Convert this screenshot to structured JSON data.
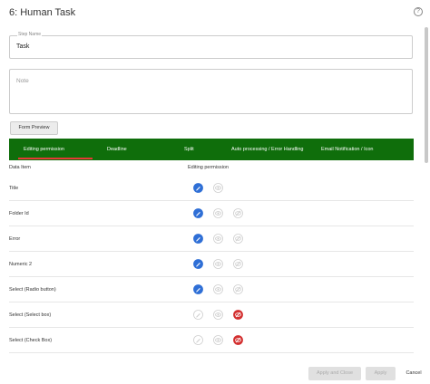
{
  "window": {
    "title": "6: Human Task"
  },
  "step_name": {
    "label": "Step Name",
    "value": "Task"
  },
  "note": {
    "placeholder": "Note"
  },
  "form_preview_label": "Form Preview",
  "tabs": [
    {
      "label": "Editing permission",
      "active": true
    },
    {
      "label": "Deadline",
      "active": false
    },
    {
      "label": "Split",
      "active": false
    },
    {
      "label": "Auto processing / Error Handling",
      "active": false
    },
    {
      "label": "Email Notification / Icon",
      "active": false
    }
  ],
  "table": {
    "headers": [
      "Data Item",
      "Editing permission"
    ],
    "rows": [
      {
        "label": "Title",
        "icons": [
          "edit-active",
          "view-inactive"
        ]
      },
      {
        "label": "Folder Id",
        "icons": [
          "edit-active",
          "view-inactive",
          "hidden-inactive"
        ]
      },
      {
        "label": "Error",
        "icons": [
          "edit-active",
          "view-inactive",
          "hidden-inactive"
        ]
      },
      {
        "label": "Numeric 2",
        "icons": [
          "edit-active",
          "view-inactive",
          "hidden-inactive"
        ]
      },
      {
        "label": "Select (Radio button)",
        "icons": [
          "edit-active",
          "view-inactive",
          "hidden-inactive"
        ]
      },
      {
        "label": "Select (Select box)",
        "icons": [
          "edit-inactive",
          "view-inactive",
          "hidden-active"
        ]
      },
      {
        "label": "Select (Check Box)",
        "icons": [
          "edit-inactive",
          "view-inactive",
          "hidden-active"
        ]
      }
    ]
  },
  "footer": {
    "apply_close": "Apply and Close",
    "apply": "Apply",
    "cancel": "Cancel"
  },
  "colors": {
    "tab_bar": "#0f6e0b",
    "active_tab_underline": "#e53935",
    "edit_active": "#2f6fd6",
    "hidden_active": "#d32f2f"
  }
}
